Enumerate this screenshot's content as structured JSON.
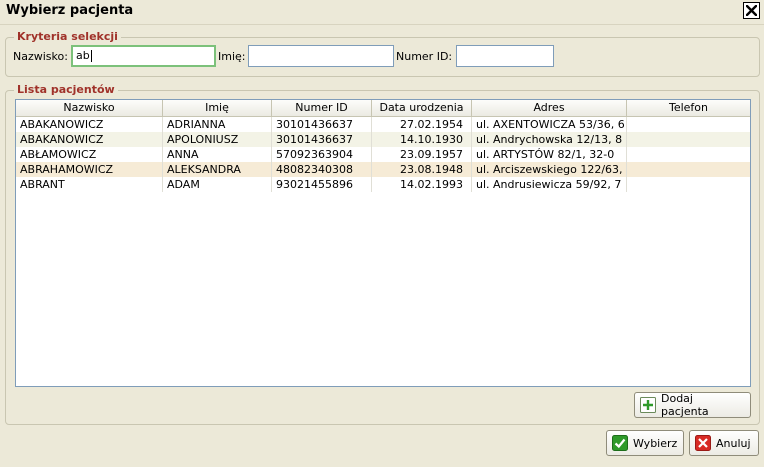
{
  "window": {
    "title": "Wybierz pacjenta"
  },
  "criteria": {
    "legend": "Kryteria selekcji",
    "surname_label": "Nazwisko:",
    "surname_value": "ab",
    "name_label": "Imię:",
    "name_value": "",
    "id_label": "Numer ID:",
    "id_value": ""
  },
  "list": {
    "legend": "Lista pacjentów",
    "columns": [
      "Nazwisko",
      "Imię",
      "Numer ID",
      "Data urodzenia",
      "Adres",
      "Telefon"
    ],
    "rows": [
      {
        "surname": "ABAKANOWICZ",
        "name": "ADRIANNA",
        "id": "30101436637",
        "dob": "27.02.1954",
        "address": "ul. AXENTOWICZA 53/36, 6",
        "phone": ""
      },
      {
        "surname": "ABAKANOWICZ",
        "name": "APOLONIUSZ",
        "id": "30101436637",
        "dob": "14.10.1930",
        "address": "ul. Andrychowska 12/13, 8",
        "phone": ""
      },
      {
        "surname": "ABŁAMOWICZ",
        "name": "ANNA",
        "id": "57092363904",
        "dob": "23.09.1957",
        "address": "ul. ARTYSTÓW 82/1, 32-0",
        "phone": ""
      },
      {
        "surname": "ABRAHAMOWICZ",
        "name": "ALEKSANDRA",
        "id": "48082340308",
        "dob": "23.08.1948",
        "address": "ul. Arciszewskiego 122/63,",
        "phone": ""
      },
      {
        "surname": "ABRANT",
        "name": "ADAM",
        "id": "93021455896",
        "dob": "14.02.1993",
        "address": "ul. Andrusiewicza 59/92, 7",
        "phone": ""
      }
    ]
  },
  "buttons": {
    "add_patient": "Dodaj pacjenta",
    "select": "Wybierz",
    "cancel": "Anuluj"
  },
  "icons": {
    "close": "close-icon",
    "add": "plus-icon",
    "ok": "check-icon",
    "cancel": "cancel-icon"
  },
  "colors": {
    "legend_text": "#a0322a",
    "selected_row": "#f6ebd6",
    "focus_border": "#7cc17a"
  }
}
